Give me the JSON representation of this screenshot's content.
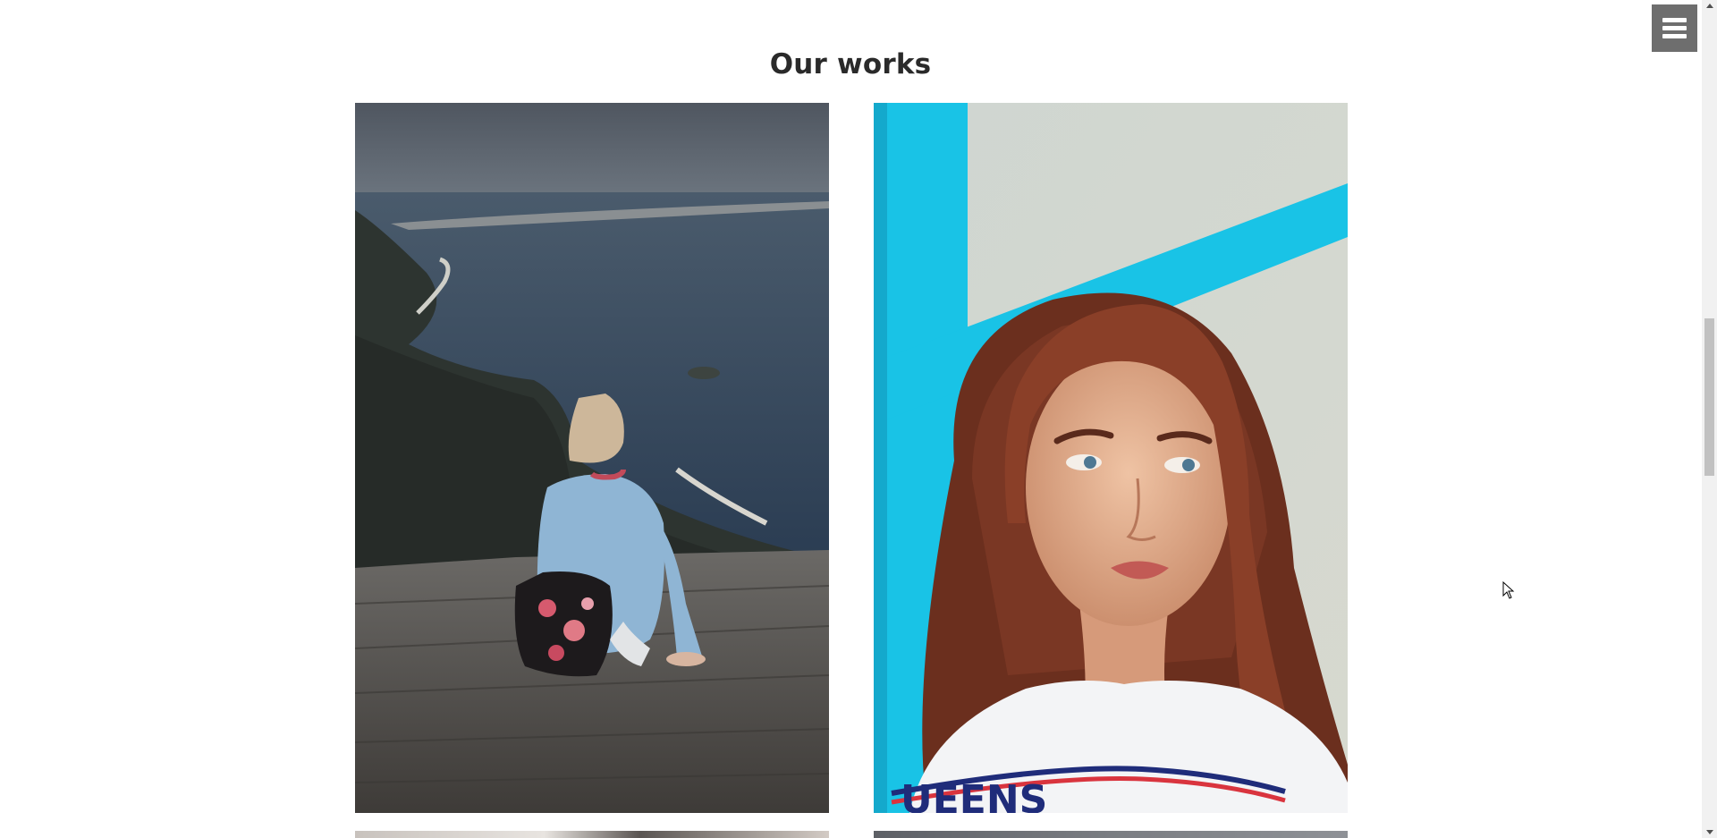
{
  "section": {
    "title": "Our works"
  },
  "gallery": {
    "items": [
      {
        "subject": "woman-with-backpack-on-cliff-overlooking-sea"
      },
      {
        "subject": "portrait-red-haired-woman-blue-frame"
      },
      {
        "subject": "partial-photo-row-3-left"
      },
      {
        "subject": "partial-photo-row-3-right"
      }
    ],
    "shirt_text": "UEENS"
  },
  "menu": {
    "icon": "hamburger-menu-icon"
  },
  "colors": {
    "background": "#ffffff",
    "title": "#2a2a2a",
    "menu_button": "#6e6e6e",
    "frame_cyan": "#19c3e6"
  }
}
